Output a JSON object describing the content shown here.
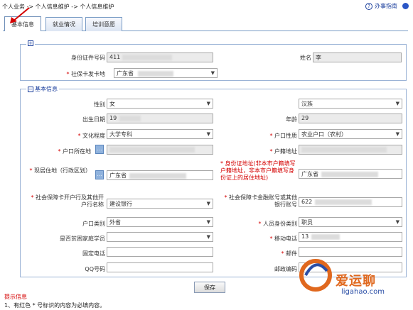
{
  "breadcrumb": "个人业务 -> 个人信息维护 -> 个人信息维护",
  "guide": {
    "label": "办事指南"
  },
  "tabs": [
    {
      "label": "基本信息",
      "active": true
    },
    {
      "label": "就业情况",
      "active": false
    },
    {
      "label": "培训意愿",
      "active": false
    }
  ],
  "identity": {
    "id_label": "身份证件号码",
    "id_value": "411",
    "name_label": "姓名",
    "name_value": "李",
    "card_issuer_label": "社保卡发卡地",
    "card_issuer_value": "广东省"
  },
  "basic": {
    "legend": "基本信息",
    "gender_label": "性别",
    "gender_value": "女",
    "ethnicity_label": "民族",
    "ethnicity_value": "汉族",
    "birth_label": "出生日期",
    "birth_value": "19",
    "age_label": "年龄",
    "age_value": "29",
    "education_label": "文化程度",
    "education_value": "大学专科",
    "hukou_type_label": "户口性质",
    "hukou_type_value": "农业户口（农村）",
    "hukou_loc_label": "户口所在地",
    "hukou_addr_label": "户籍地址",
    "residence_label": "现居住地（行政区划）",
    "residence_value": "广东省",
    "id_addr_label": "身份证地址(非本市户籍填写户籍地址，非本市户籍填写身份证上的居住地址)",
    "id_addr_value": "广东省",
    "bank_label": "社会保障卡开户行及其他开户行名称",
    "bank_value": "建设银行",
    "bank_acct_label": "社会保障卡金融账号或其他银行账号",
    "bank_acct_value": "622",
    "hukou_cat_label": "户口类别",
    "hukou_cat_value": "外省",
    "person_type_label": "人员身份类别",
    "person_type_value": "职员",
    "hardship_label": "是否贫困家庭学员",
    "mobile_label": "移动电话",
    "mobile_value": "13",
    "fixed_phone_label": "固定电话",
    "email_label": "邮件",
    "qq_label": "QQ号码",
    "postcode_label": "邮政编码"
  },
  "save_label": "保存",
  "hint": {
    "title": "提示信息",
    "line1": "1、有红色 * 号标识的内容为必填内容。"
  },
  "watermark": {
    "text": "爱运聊",
    "url": "ligahao.com"
  },
  "colors": {
    "accent": "#1a3e9c",
    "required": "#d40000",
    "border": "#9bb3d6"
  }
}
